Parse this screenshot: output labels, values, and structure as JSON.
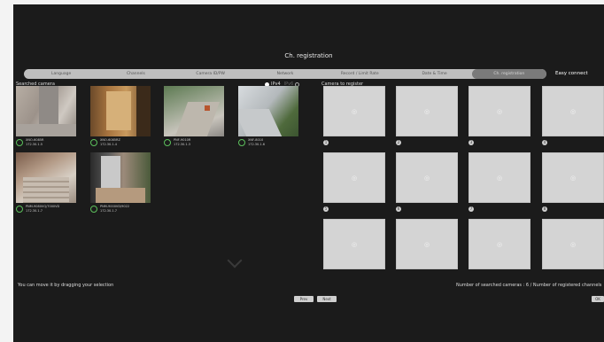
{
  "title": "Ch. registration",
  "tabs": [
    {
      "label": "Language"
    },
    {
      "label": "Channels"
    },
    {
      "label": "Camera ID/PW"
    },
    {
      "label": "Network"
    },
    {
      "label": "Record / Limit Rate"
    },
    {
      "label": "Date & Time"
    },
    {
      "label": "Ch. registration",
      "active": true
    }
  ],
  "easy_connect_label": "Easy connect",
  "searched": {
    "label": "Searched camera",
    "ip_options": [
      {
        "label": "IPv4",
        "selected": true
      },
      {
        "label": "IPv6",
        "selected": false
      }
    ],
    "cameras": [
      {
        "model": "XNO-6085R",
        "ip": "172.30.1.5"
      },
      {
        "model": "XNO-6085RZ",
        "ip": "172.30.1.4"
      },
      {
        "model": "PNF-9010R",
        "ip": "172.30.1.3"
      },
      {
        "model": "XNF-8010",
        "ip": "172.30.1.6"
      },
      {
        "model": "PNM-9080VQ/7000VD",
        "ip": "172.30.1.7"
      },
      {
        "model": "PNM-9000VD/9022",
        "ip": "172.30.1.7"
      }
    ]
  },
  "register": {
    "label": "Camera to register",
    "slots": [
      1,
      2,
      3,
      4,
      5,
      6,
      7,
      8,
      9,
      10,
      11,
      12
    ]
  },
  "hint": "You can move it by dragging your selection",
  "counts_label": "Number of searched cameras : 6 / Number of registered channels",
  "buttons": {
    "prev": "Prev",
    "next": "Next",
    "extra": "OK"
  }
}
